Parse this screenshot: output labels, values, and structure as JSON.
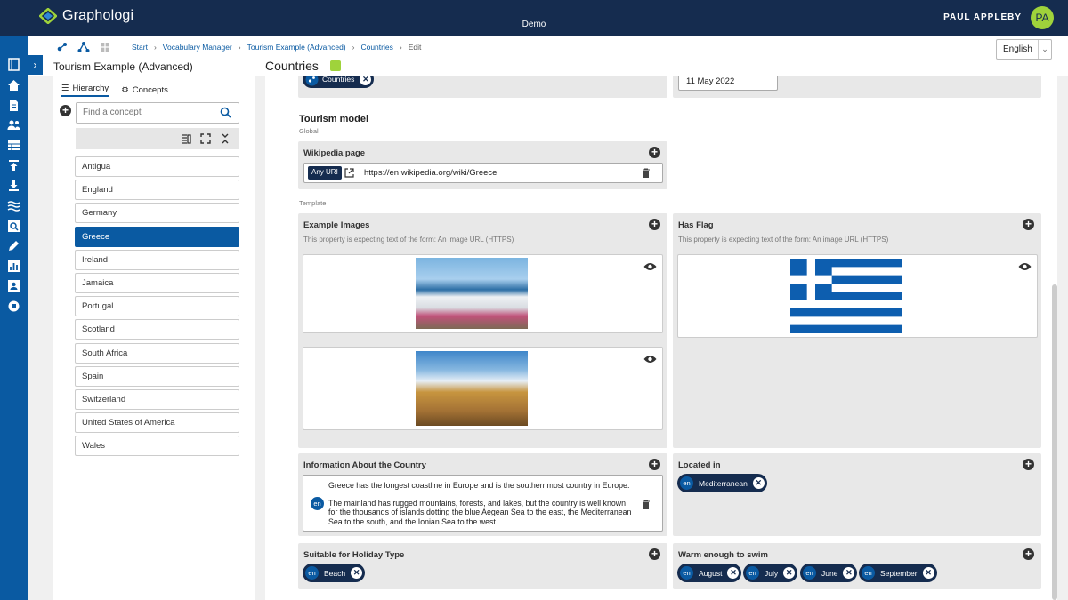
{
  "app": {
    "name": "Graphologi",
    "project": "Demo",
    "user": "PAUL APPLEBY",
    "initials": "PA"
  },
  "breadcrumbs": [
    "Start",
    "Vocabulary Manager",
    "Tourism Example (Advanced)",
    "Countries",
    "Edit"
  ],
  "language": "English",
  "left_title": "Tourism Example (Advanced)",
  "tabs": {
    "hierarchy": "Hierarchy",
    "concepts": "Concepts"
  },
  "search_placeholder": "Find a concept",
  "concepts": [
    "Antigua",
    "England",
    "Germany",
    "Greece",
    "Ireland",
    "Jamaica",
    "Portugal",
    "Scotland",
    "South Africa",
    "Spain",
    "Switzerland",
    "United States of America",
    "Wales"
  ],
  "selected_concept": "Greece",
  "main_title": "Countries",
  "top_chip": "Countries",
  "date_value": "11 May 2022",
  "tourism": {
    "title": "Tourism model",
    "scope": "Global",
    "template": "Template"
  },
  "wikipedia": {
    "label": "Wikipedia page",
    "type": "Any URI",
    "url": "https://en.wikipedia.org/wiki/Greece"
  },
  "example_images": {
    "label": "Example Images",
    "hint": "This property is expecting text of the form: An image URL (HTTPS)"
  },
  "has_flag": {
    "label": "Has Flag",
    "hint": "This property is expecting text of the form: An image URL (HTTPS)"
  },
  "info": {
    "label": "Information About the Country",
    "lang": "en",
    "para1": "Greece has the longest coastline in Europe and is the southernmost country in Europe.",
    "para2": "The mainland has rugged mountains, forests, and lakes, but the country is well known for the thousands of islands dotting the blue Aegean Sea to the east, the Mediterranean Sea to the south, and the Ionian Sea to the west."
  },
  "located_in": {
    "label": "Located in",
    "chips": [
      {
        "lang": "en",
        "text": "Mediterranean"
      }
    ]
  },
  "holiday": {
    "label": "Suitable for Holiday Type",
    "chips": [
      {
        "lang": "en",
        "text": "Beach"
      }
    ]
  },
  "swim": {
    "label": "Warm enough to swim",
    "chips": [
      {
        "lang": "en",
        "text": "August"
      },
      {
        "lang": "en",
        "text": "July"
      },
      {
        "lang": "en",
        "text": "June"
      },
      {
        "lang": "en",
        "text": "September"
      }
    ]
  },
  "colors": {
    "navy": "#152c4f",
    "blue": "#0a5aa2",
    "green": "#9fd33b"
  }
}
